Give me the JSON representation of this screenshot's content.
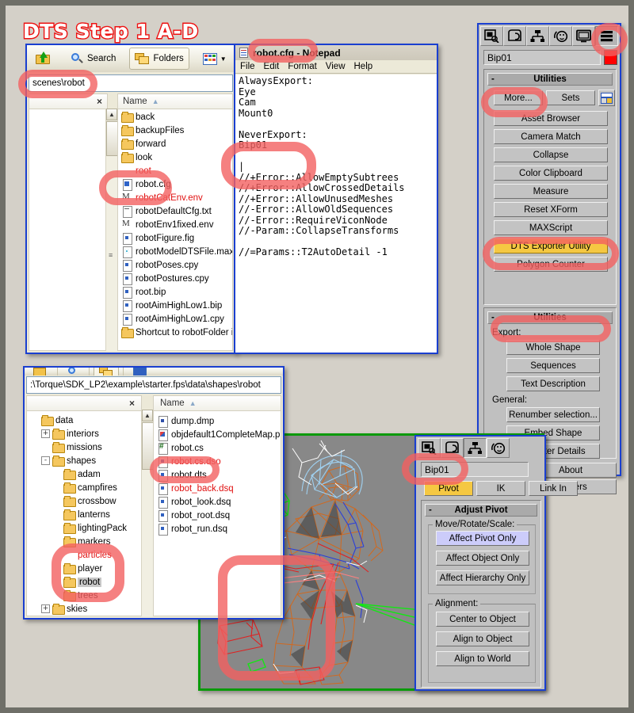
{
  "title": "DTS Step 1 A-D",
  "colors": {
    "background": "#d4d0c8",
    "annotation_red": "#f26060",
    "title_outline": "#ee1111",
    "window_blue": "#1a3fd0",
    "window_green": "#0a9a0a",
    "max_highlight_yellow": "#f5c842",
    "max_panel_gray": "#c0c0c0",
    "viewport_gray": "#888888"
  },
  "explorer_top": {
    "toolbar": {
      "up_icon": "folder-up-icon",
      "search_icon": "magnifier-icon",
      "search_label": "Search",
      "folders_icon": "folders-icon",
      "folders_label": "Folders",
      "views_icon": "views-grid-icon",
      "views_chevron": "chevron-down-icon"
    },
    "address_value": "scenes\\robot",
    "close_label": "×",
    "column_header": "Name",
    "sort_arrow": "sort-ascending-icon",
    "files": [
      {
        "name": "back",
        "icon": "folder",
        "red": false
      },
      {
        "name": "backupFiles",
        "icon": "folder",
        "red": false
      },
      {
        "name": "forward",
        "icon": "folder",
        "red": false
      },
      {
        "name": "look",
        "icon": "folder",
        "red": false
      },
      {
        "name": "root",
        "icon": "folder-red",
        "red": true
      },
      {
        "name": "robot.cfg",
        "icon": "file fileblue",
        "red": false
      },
      {
        "name": "robotCatEnv.env",
        "icon": "file filem",
        "red": true
      },
      {
        "name": "robotDefaultCfg.txt",
        "icon": "file filetxt",
        "red": false
      },
      {
        "name": "robotEnv1fixed.env",
        "icon": "file filem",
        "red": false
      },
      {
        "name": "robotFigure.fig",
        "icon": "file filegrid",
        "red": false
      },
      {
        "name": "robotModelDTSFile.max",
        "icon": "file filespiral",
        "red": false
      },
      {
        "name": "robotPoses.cpy",
        "icon": "file filegrid",
        "red": false
      },
      {
        "name": "robotPostures.cpy",
        "icon": "file filegrid",
        "red": false
      },
      {
        "name": "root.bip",
        "icon": "file filegrid",
        "red": false
      },
      {
        "name": "rootAimHighLow1.bip",
        "icon": "file filegrid",
        "red": false
      },
      {
        "name": "rootAimHighLow1.cpy",
        "icon": "file filegrid",
        "red": false
      },
      {
        "name": "Shortcut to robotFolder in TGE",
        "icon": "folder",
        "red": false
      }
    ]
  },
  "notepad": {
    "titlebar_icon": "notepad-icon",
    "title": "robot.cfg - Notepad",
    "menu": [
      "File",
      "Edit",
      "Format",
      "View",
      "Help"
    ],
    "content": "AlwaysExport:\nEye\nCam\nMount0\n\nNeverExport:\nBip01\n\n|\n//+Error::AllowEmptySubtrees\n//+Error::AllowCrossedDetails\n//+Error::AllowUnusedMeshes\n//-Error::AllowOldSequences\n//-Error::RequireViconNode\n//-Param::CollapseTransforms\n\n//=Params::T2AutoDetail -1"
  },
  "max_utilities": {
    "tabs": [
      {
        "name": "create-tab",
        "icon": "create-icon",
        "active": false
      },
      {
        "name": "modify-tab",
        "icon": "modify-icon",
        "active": false
      },
      {
        "name": "hierarchy-tab",
        "icon": "hierarchy-icon",
        "active": false
      },
      {
        "name": "motion-tab",
        "icon": "motion-icon",
        "active": false
      },
      {
        "name": "display-tab",
        "icon": "display-icon",
        "active": false
      },
      {
        "name": "utilities-tab",
        "icon": "utilities-icon",
        "active": true
      }
    ],
    "object_name": "Bip01",
    "rollout1_title": "Utilities",
    "rollout1_minus": "-",
    "more_label": "More...",
    "sets_label": "Sets",
    "config_icon": "configure-button-sets-icon",
    "buttons": [
      {
        "label": "Asset Browser",
        "style": "normal"
      },
      {
        "label": "Camera Match",
        "style": "normal"
      },
      {
        "label": "Collapse",
        "style": "normal"
      },
      {
        "label": "Color Clipboard",
        "style": "normal"
      },
      {
        "label": "Measure",
        "style": "normal"
      },
      {
        "label": "Reset XForm",
        "style": "normal"
      },
      {
        "label": "MAXScript",
        "style": "normal"
      },
      {
        "label": "DTS Exporter Utility",
        "style": "yellow"
      },
      {
        "label": "Polygon Counter",
        "style": "normal"
      }
    ],
    "rollout2_title": "Utilities",
    "rollout2_minus": "-",
    "export_group_label": "Export:",
    "export_buttons": [
      "Whole Shape",
      "Sequences",
      "Text Description"
    ],
    "general_group_label": "General:",
    "general_buttons": [
      "Renumber selection...",
      "Embed Shape",
      "Register Details"
    ],
    "about_label": "About",
    "parameters_label": "ameters"
  },
  "explorer_bottom": {
    "address_value": ":\\Torque\\SDK_LP2\\example\\starter.fps\\data\\shapes\\robot",
    "close_label": "×",
    "column_header": "Name",
    "sort_arrow": "sort-ascending-icon",
    "tree": [
      {
        "name": "data",
        "indent": 0,
        "expander": "",
        "icon": "folder",
        "red": false,
        "highlight": false
      },
      {
        "name": "interiors",
        "indent": 1,
        "expander": "+",
        "icon": "folder",
        "red": false,
        "highlight": false
      },
      {
        "name": "missions",
        "indent": 1,
        "expander": "",
        "icon": "folder",
        "red": false,
        "highlight": false
      },
      {
        "name": "shapes",
        "indent": 1,
        "expander": "-",
        "icon": "folder",
        "red": false,
        "highlight": false
      },
      {
        "name": "adam",
        "indent": 2,
        "expander": "",
        "icon": "folder",
        "red": false,
        "highlight": false
      },
      {
        "name": "campfires",
        "indent": 2,
        "expander": "",
        "icon": "folder",
        "red": false,
        "highlight": false
      },
      {
        "name": "crossbow",
        "indent": 2,
        "expander": "",
        "icon": "folder",
        "red": false,
        "highlight": false
      },
      {
        "name": "lanterns",
        "indent": 2,
        "expander": "",
        "icon": "folder",
        "red": false,
        "highlight": false
      },
      {
        "name": "lightingPack",
        "indent": 2,
        "expander": "",
        "icon": "folder",
        "red": false,
        "highlight": false
      },
      {
        "name": "markers",
        "indent": 2,
        "expander": "",
        "icon": "folder",
        "red": false,
        "highlight": false
      },
      {
        "name": "particles",
        "indent": 2,
        "expander": "",
        "icon": "folder-red",
        "red": true,
        "highlight": false
      },
      {
        "name": "player",
        "indent": 2,
        "expander": "",
        "icon": "folder",
        "red": false,
        "highlight": false
      },
      {
        "name": "robot",
        "indent": 2,
        "expander": "",
        "icon": "folder",
        "red": false,
        "highlight": true
      },
      {
        "name": "trees",
        "indent": 2,
        "expander": "",
        "icon": "folder",
        "red": false,
        "highlight": false
      },
      {
        "name": "skies",
        "indent": 1,
        "expander": "+",
        "icon": "folder",
        "red": false,
        "highlight": false
      }
    ],
    "files": [
      {
        "name": "dump.dmp",
        "icon": "file filedmp",
        "red": false
      },
      {
        "name": "objdefault1CompleteMap.png",
        "icon": "file filepng",
        "red": false
      },
      {
        "name": "robot.cs",
        "icon": "file filecs",
        "red": false
      },
      {
        "name": "robot.cs.dso",
        "icon": "file filegrid",
        "red": true
      },
      {
        "name": "robot.dts",
        "icon": "file filegrid",
        "red": false
      },
      {
        "name": "robot_back.dsq",
        "icon": "file filegrid",
        "red": true
      },
      {
        "name": "robot_look.dsq",
        "icon": "file filegrid",
        "red": false
      },
      {
        "name": "robot_root.dsq",
        "icon": "file filegrid",
        "red": false
      },
      {
        "name": "robot_run.dsq",
        "icon": "file filegrid",
        "red": false
      }
    ]
  },
  "max_hierarchy": {
    "tabs": [
      {
        "name": "create-tab",
        "icon": "create-icon",
        "active": false
      },
      {
        "name": "modify-tab",
        "icon": "modify-icon",
        "active": false
      },
      {
        "name": "hierarchy-tab",
        "icon": "hierarchy-icon",
        "active": true
      },
      {
        "name": "motion-tab",
        "icon": "motion-icon",
        "active": false
      }
    ],
    "object_name": "Bip01",
    "subtabs": [
      {
        "label": "Pivot",
        "active": true
      },
      {
        "label": "IK",
        "active": false
      },
      {
        "label": "Link In",
        "active": false
      }
    ],
    "rollout_title": "Adjust Pivot",
    "rollout_minus": "-",
    "group1_label": "Move/Rotate/Scale:",
    "group1_buttons": [
      {
        "label": "Affect Pivot Only",
        "style": "lilac"
      },
      {
        "label": "Affect Object Only",
        "style": "normal"
      },
      {
        "label": "Affect Hierarchy Only",
        "style": "normal"
      }
    ],
    "group2_label": "Alignment:",
    "group2_buttons": [
      {
        "label": "Center to Object",
        "style": "normal"
      },
      {
        "label": "Align to Object",
        "style": "normal"
      },
      {
        "label": "Align to World",
        "style": "normal"
      }
    ]
  },
  "viewport": {
    "description": "3ds Max perspective viewport showing a wireframe biped character mesh with orange edges, blue/white helper splines, green gizmo boxes and red selection lines on gray background"
  },
  "annotations": [
    {
      "name": "address-scenes-robot-highlight",
      "shape": "ellipse"
    },
    {
      "name": "robot-cfg-file-highlight",
      "shape": "ellipse"
    },
    {
      "name": "notepad-title-highlight",
      "shape": "ellipse"
    },
    {
      "name": "never-export-bip01-highlight",
      "shape": "rounded-rect"
    },
    {
      "name": "utilities-tab-highlight",
      "shape": "ellipse"
    },
    {
      "name": "more-button-highlight",
      "shape": "ellipse"
    },
    {
      "name": "dts-exporter-utility-highlight",
      "shape": "ellipse"
    },
    {
      "name": "whole-shape-button-highlight",
      "shape": "ellipse"
    },
    {
      "name": "robot-dts-file-highlight",
      "shape": "ellipse"
    },
    {
      "name": "robot-folder-tree-highlight",
      "shape": "rounded-rect"
    },
    {
      "name": "bip01-name-field-highlight",
      "shape": "ellipse"
    },
    {
      "name": "viewport-pivot-highlight",
      "shape": "rounded-rect"
    }
  ]
}
